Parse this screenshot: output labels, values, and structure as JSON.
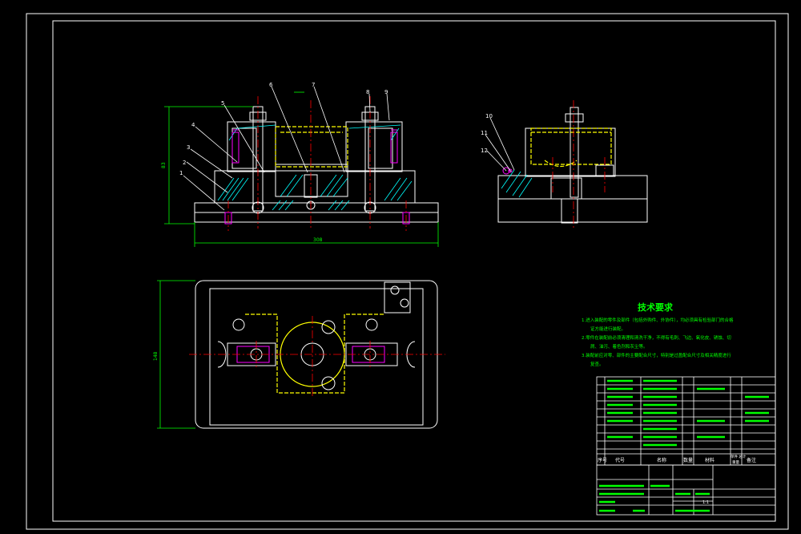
{
  "colors": {
    "background": "#000000",
    "outline": "#ffffff",
    "dimension": "#00ff00",
    "centerline": "#ff0000",
    "hatch": "#00ffff",
    "workpiece": "#ffff00",
    "fastener": "#ff00ff",
    "text": "#00ff00"
  },
  "part_numbers": {
    "n1": "1",
    "n2": "2",
    "n3": "3",
    "n4": "4",
    "n5": "5",
    "n6": "6",
    "n7": "7",
    "n8": "8",
    "n9": "9",
    "n10": "10",
    "n11": "11",
    "n12": "12"
  },
  "dimensions": {
    "height": "83",
    "overall_length": "308",
    "plan_width": "148"
  },
  "tech_requirements": {
    "title": "技术要求",
    "line1": "1.进入装配的零件及部件（包括外购件、外协件），均必须具有检验部门的合格",
    "line2": "证方能进行装配。",
    "line3": "2.零件在装配前必须清理和清洗干净，不得有毛刺、飞边、氧化皮、锈蚀、切",
    "line4": "屑、油污、着色剂和灰尘等。",
    "line5": "3.装配前应对零、部件的主要配合尺寸，特别是过盈配合尺寸及相关精度进行",
    "line6": "复查。"
  },
  "title_block": {
    "col_seq": "序号",
    "col_code": "代号",
    "col_name": "名称",
    "col_qty": "数量",
    "col_material": "材料",
    "col_weight": "单件 总计",
    "col_weight2": "重量",
    "col_remark": "备注",
    "scale": "1:1"
  }
}
